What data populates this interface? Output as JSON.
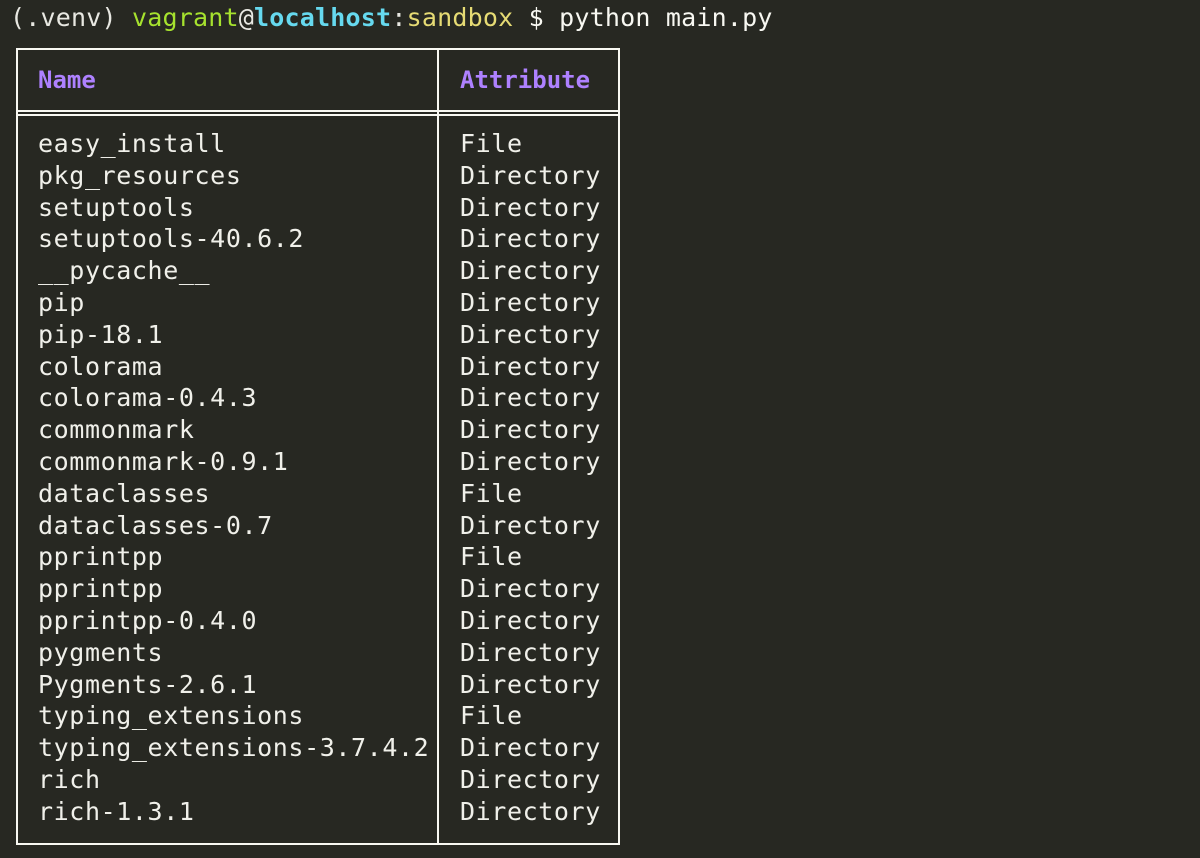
{
  "prompt": {
    "venv": "(.venv) ",
    "user": "vagrant",
    "at": "@",
    "host": "localhost",
    "colon": ":",
    "dir": "sandbox",
    "command": " $ python main.py"
  },
  "table": {
    "headers": [
      "Name",
      "Attribute"
    ],
    "rows": [
      {
        "name": "easy_install",
        "attribute": "File"
      },
      {
        "name": "pkg_resources",
        "attribute": "Directory"
      },
      {
        "name": "setuptools",
        "attribute": "Directory"
      },
      {
        "name": "setuptools-40.6.2",
        "attribute": "Directory"
      },
      {
        "name": "__pycache__",
        "attribute": "Directory"
      },
      {
        "name": "pip",
        "attribute": "Directory"
      },
      {
        "name": "pip-18.1",
        "attribute": "Directory"
      },
      {
        "name": "colorama",
        "attribute": "Directory"
      },
      {
        "name": "colorama-0.4.3",
        "attribute": "Directory"
      },
      {
        "name": "commonmark",
        "attribute": "Directory"
      },
      {
        "name": "commonmark-0.9.1",
        "attribute": "Directory"
      },
      {
        "name": "dataclasses",
        "attribute": "File"
      },
      {
        "name": "dataclasses-0.7",
        "attribute": "Directory"
      },
      {
        "name": "pprintpp",
        "attribute": "File"
      },
      {
        "name": "pprintpp",
        "attribute": "Directory"
      },
      {
        "name": "pprintpp-0.4.0",
        "attribute": "Directory"
      },
      {
        "name": "pygments",
        "attribute": "Directory"
      },
      {
        "name": "Pygments-2.6.1",
        "attribute": "Directory"
      },
      {
        "name": "typing_extensions",
        "attribute": "File"
      },
      {
        "name": "typing_extensions-3.7.4.2",
        "attribute": "Directory"
      },
      {
        "name": "rich",
        "attribute": "Directory"
      },
      {
        "name": "rich-1.3.1",
        "attribute": "Directory"
      }
    ]
  },
  "colors": {
    "background": "#272822",
    "foreground": "#f8f8f2",
    "user": "#a6e22e",
    "host": "#66d9ef",
    "dir": "#e6db74",
    "header": "#ae81ff"
  }
}
